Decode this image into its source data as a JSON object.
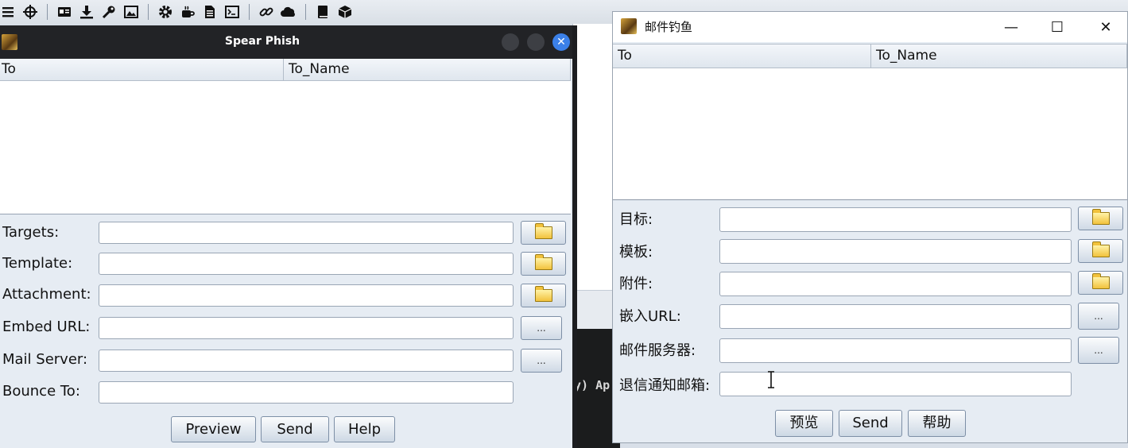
{
  "toolbar": {
    "icons": [
      "menu-icon",
      "crosshair-icon",
      "id-card-icon",
      "download-icon",
      "key-icon",
      "image-icon",
      "gear-icon",
      "coffee-icon",
      "document-icon",
      "terminal-icon",
      "link-icon",
      "cloud-icon",
      "book-icon",
      "package-icon"
    ]
  },
  "background": {
    "console_text": "y) Ap"
  },
  "spear_phish": {
    "title": "Spear Phish",
    "columns": [
      "To",
      "To_Name"
    ],
    "fields": [
      {
        "label": "Targets:",
        "value": "",
        "button": "folder"
      },
      {
        "label": "Template:",
        "value": "",
        "button": "folder"
      },
      {
        "label": "Attachment:",
        "value": "",
        "button": "folder"
      },
      {
        "label": "Embed URL:",
        "value": "",
        "button": "..."
      },
      {
        "label": "Mail Server:",
        "value": "",
        "button": "..."
      },
      {
        "label": "Bounce To:",
        "value": "",
        "button": ""
      }
    ],
    "buttons": {
      "preview": "Preview",
      "send": "Send",
      "help": "Help"
    },
    "close_glyph": "✕"
  },
  "mail_phish": {
    "title": "邮件钓鱼",
    "controls": {
      "minimize": "—",
      "maximize": "☐",
      "close": "✕"
    },
    "columns": [
      "To",
      "To_Name"
    ],
    "fields": [
      {
        "label": "目标:",
        "value": "",
        "button": "folder"
      },
      {
        "label": "模板:",
        "value": "",
        "button": "folder"
      },
      {
        "label": "附件:",
        "value": "",
        "button": "folder"
      },
      {
        "label": "嵌入URL:",
        "value": "",
        "button": "..."
      },
      {
        "label": "邮件服务器:",
        "value": "",
        "button": "..."
      },
      {
        "label": "退信通知邮箱:",
        "value": "",
        "button": ""
      }
    ],
    "buttons": {
      "preview": "预览",
      "send": "Send",
      "help": "帮助"
    }
  }
}
